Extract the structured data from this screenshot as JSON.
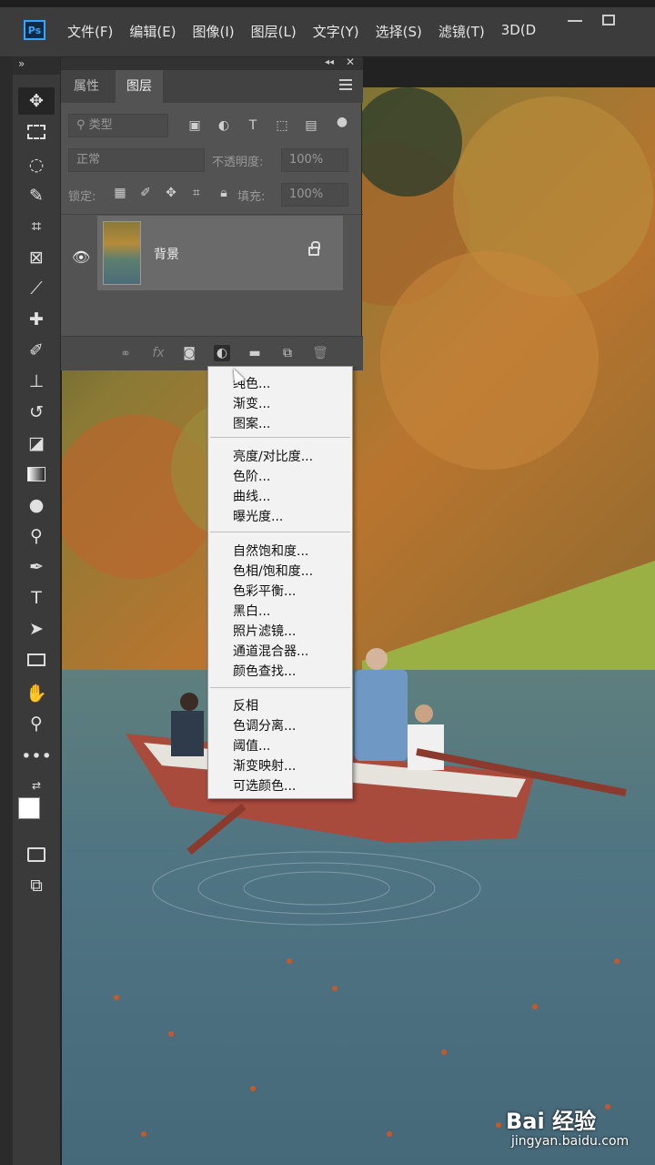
{
  "app": {
    "logo": "Ps"
  },
  "menubar": [
    "文件(F)",
    "编辑(E)",
    "图像(I)",
    "图层(L)",
    "文字(Y)",
    "选择(S)",
    "滤镜(T)",
    "3D(D"
  ],
  "toolbar": {
    "collapse": "»"
  },
  "layers_panel": {
    "tabs": [
      "属性",
      "图层"
    ],
    "active_tab": "图层",
    "filter_placeholder": "类型",
    "blend_mode": "正常",
    "opacity_label": "不透明度:",
    "opacity_value": "100%",
    "lock_label": "锁定:",
    "fill_label": "填充:",
    "fill_value": "100%",
    "layer": {
      "name": "背景",
      "locked": true,
      "visible": true
    }
  },
  "adjustment_menu": {
    "groups": [
      [
        "纯色...",
        "渐变...",
        "图案..."
      ],
      [
        "亮度/对比度...",
        "色阶...",
        "曲线...",
        "曝光度..."
      ],
      [
        "自然饱和度...",
        "色相/饱和度...",
        "色彩平衡...",
        "黑白...",
        "照片滤镜...",
        "通道混合器...",
        "颜色查找..."
      ],
      [
        "反相",
        "色调分离...",
        "阈值...",
        "渐变映射...",
        "可选颜色..."
      ]
    ]
  },
  "watermark": {
    "logo": "Bai 经验",
    "url": "jingyan.baidu.com"
  },
  "colors": {
    "ps_blue": "#31a8ff",
    "panel_bg": "#535353",
    "menu_bg": "#f2f2f2"
  }
}
